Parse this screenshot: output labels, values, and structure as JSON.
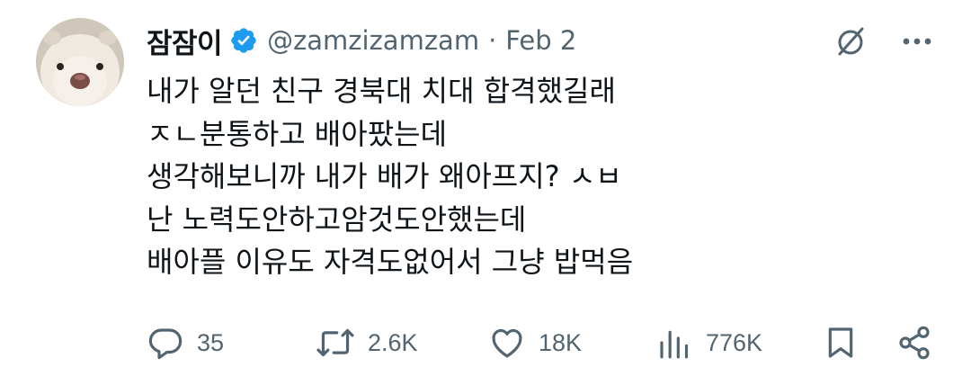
{
  "tweet": {
    "author": {
      "display_name": "잠잠이",
      "handle": "@zamzizamzam",
      "verified": true,
      "avatar_icon": "hamster-avatar"
    },
    "separator": "·",
    "date": "Feb 2",
    "lines": [
      "내가 알던 친구 경북대 치대 합격했길래",
      "ㅈㄴ분통하고 배아팠는데",
      "생각해보니까 내가 배가 왜아프지? ㅅㅂ",
      "난 노력도안하고암것도안했는데",
      "배아플 이유도 자격도없어서 그냥 밥먹음"
    ],
    "actions": {
      "replies": "35",
      "reposts": "2.6K",
      "likes": "18K",
      "views": "776K"
    }
  },
  "colors": {
    "text_primary": "#0f1419",
    "text_secondary": "#536471",
    "verified_blue": "#1d9bf0"
  },
  "icons": [
    "grok-slash-circle-icon",
    "more-icon",
    "reply-icon",
    "repost-icon",
    "like-icon",
    "views-icon",
    "bookmark-icon",
    "share-icon"
  ]
}
